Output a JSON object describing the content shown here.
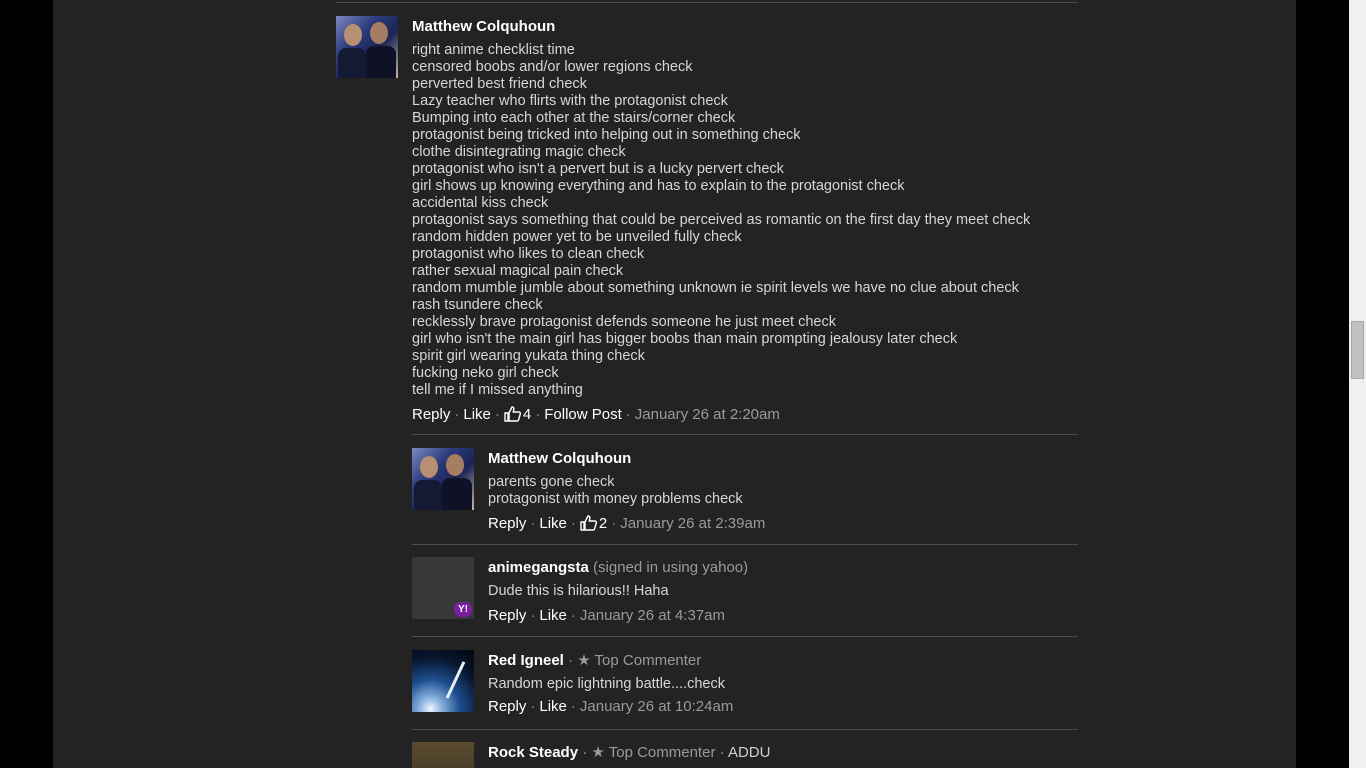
{
  "colors": {
    "background": "#000000",
    "panel": "#232323",
    "author": "#ffffff",
    "body_text": "#d6d6d6",
    "muted": "#9a9a9a",
    "yahoo": "#7b1fa2"
  },
  "comments": [
    {
      "author": "Matthew Colquhoun",
      "avatar_icon": "user-photo",
      "lines": [
        "right anime checklist time",
        "censored boobs and/or lower regions check",
        "perverted best friend check",
        "Lazy teacher who flirts with the protagonist check",
        "Bumping into each other at the stairs/corner check",
        "protagonist being tricked into helping out in something check",
        "clothe disintegrating magic check",
        "protagonist who isn't a pervert but is a lucky pervert check",
        "girl shows up knowing everything and has to explain to the protagonist check",
        "accidental kiss check",
        "protagonist says something that could be perceived as romantic on the first day they meet check",
        "random hidden power yet to be unveiled fully check",
        "protagonist who likes to clean check",
        "rather sexual magical pain check",
        "random mumble jumble about something unknown ie spirit levels we have no clue about check",
        "rash tsundere check",
        "recklessly brave protagonist defends someone he just meet check",
        "girl who isn't the main girl has bigger boobs than main prompting jealousy later check",
        "spirit girl wearing yukata thing check",
        "fucking neko girl check",
        "tell me if I missed anything"
      ],
      "reply": "Reply",
      "like": "Like",
      "likes": "4",
      "follow": "Follow Post",
      "date": "January 26 at 2:20am"
    },
    {
      "author": "Matthew Colquhoun",
      "avatar_icon": "user-photo",
      "lines": [
        "parents gone check",
        "protagonist with money problems check"
      ],
      "reply": "Reply",
      "like": "Like",
      "likes": "2",
      "date": "January 26 at 2:39am"
    },
    {
      "author": "animegangsta",
      "signin": "(signed in using yahoo)",
      "avatar_icon": "yahoo-icon",
      "badge": "Y!",
      "lines": [
        "Dude this is hilarious!! Haha"
      ],
      "reply": "Reply",
      "like": "Like",
      "date": "January 26 at 4:37am"
    },
    {
      "author": "Red Igneel",
      "top": "★ Top Commenter",
      "avatar_icon": "user-photo",
      "lines": [
        "Random epic lightning battle....check"
      ],
      "reply": "Reply",
      "like": "Like",
      "date": "January 26 at 10:24am"
    },
    {
      "author": "Rock Steady",
      "top": "★ Top Commenter",
      "affiliation": "ADDU",
      "avatar_icon": "user-photo"
    }
  ]
}
